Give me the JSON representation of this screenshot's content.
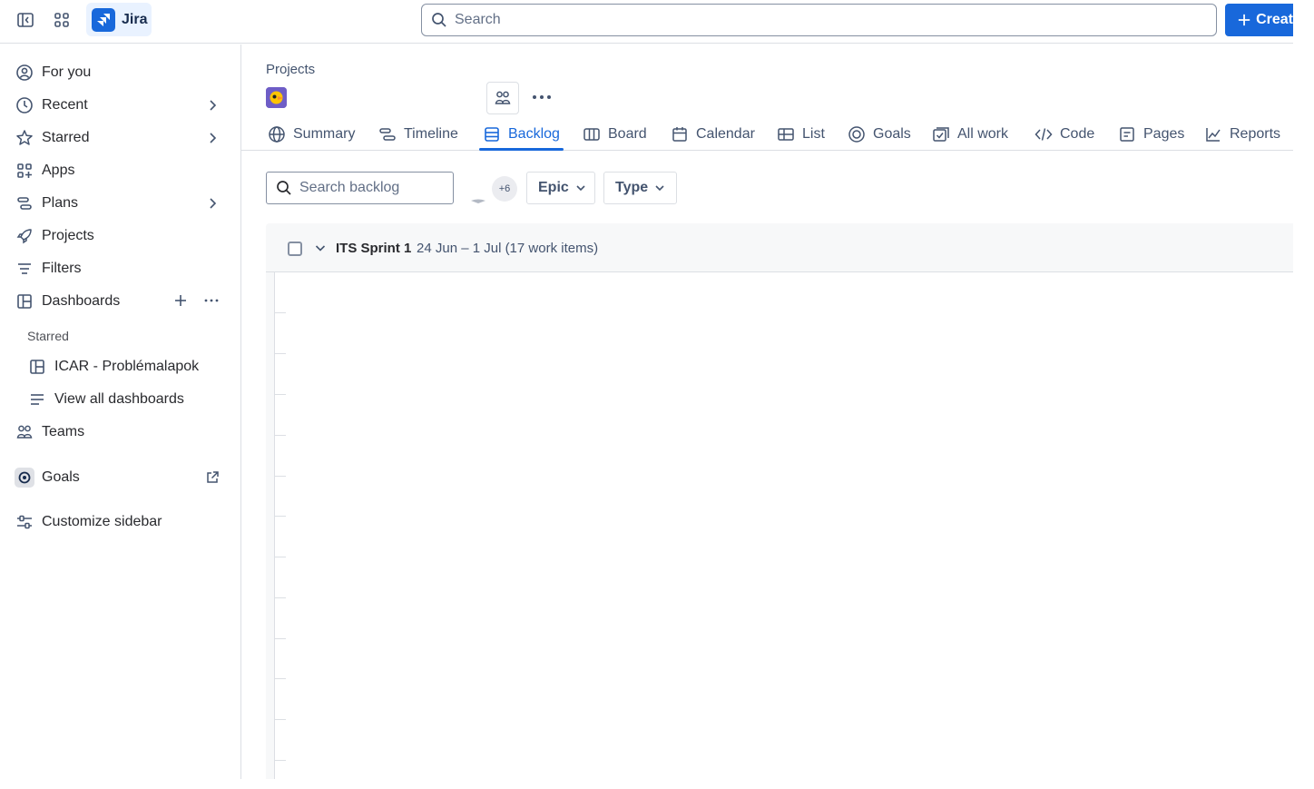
{
  "topbar": {
    "app_name": "Jira",
    "search_placeholder": "Search",
    "create_label": "Creat"
  },
  "sidebar": {
    "items": [
      {
        "label": "For you",
        "icon": "person-circle-icon"
      },
      {
        "label": "Recent",
        "icon": "clock-icon"
      },
      {
        "label": "Starred",
        "icon": "star-icon"
      },
      {
        "label": "Apps",
        "icon": "apps-icon"
      },
      {
        "label": "Plans",
        "icon": "plans-icon"
      },
      {
        "label": "Projects",
        "icon": "rocket-icon"
      },
      {
        "label": "Filters",
        "icon": "filter-icon"
      },
      {
        "label": "Dashboards",
        "icon": "dashboard-icon"
      }
    ],
    "starred_heading": "Starred",
    "starred_dashboard": "ICAR - Problémalapok",
    "view_all_dashboards": "View all dashboards",
    "teams": "Teams",
    "goals": "Goals",
    "customize": "Customize sidebar"
  },
  "header": {
    "breadcrumb": "Projects"
  },
  "tabs": [
    {
      "label": "Summary"
    },
    {
      "label": "Timeline"
    },
    {
      "label": "Backlog"
    },
    {
      "label": "Board"
    },
    {
      "label": "Calendar"
    },
    {
      "label": "List"
    },
    {
      "label": "Goals"
    },
    {
      "label": "All work"
    },
    {
      "label": "Code"
    },
    {
      "label": "Pages"
    },
    {
      "label": "Reports"
    }
  ],
  "active_tab": "Backlog",
  "toolbar": {
    "search_placeholder": "Search backlog",
    "avatar_more": "+6",
    "epic_filter": "Epic",
    "type_filter": "Type"
  },
  "sprint": {
    "name": "ITS Sprint 1",
    "meta": "24 Jun – 1 Jul (17 work items)"
  },
  "colors": {
    "brand": "#1868db",
    "border": "#dcdfe4",
    "text": "#292a2e",
    "subtle_text": "#44546f"
  }
}
